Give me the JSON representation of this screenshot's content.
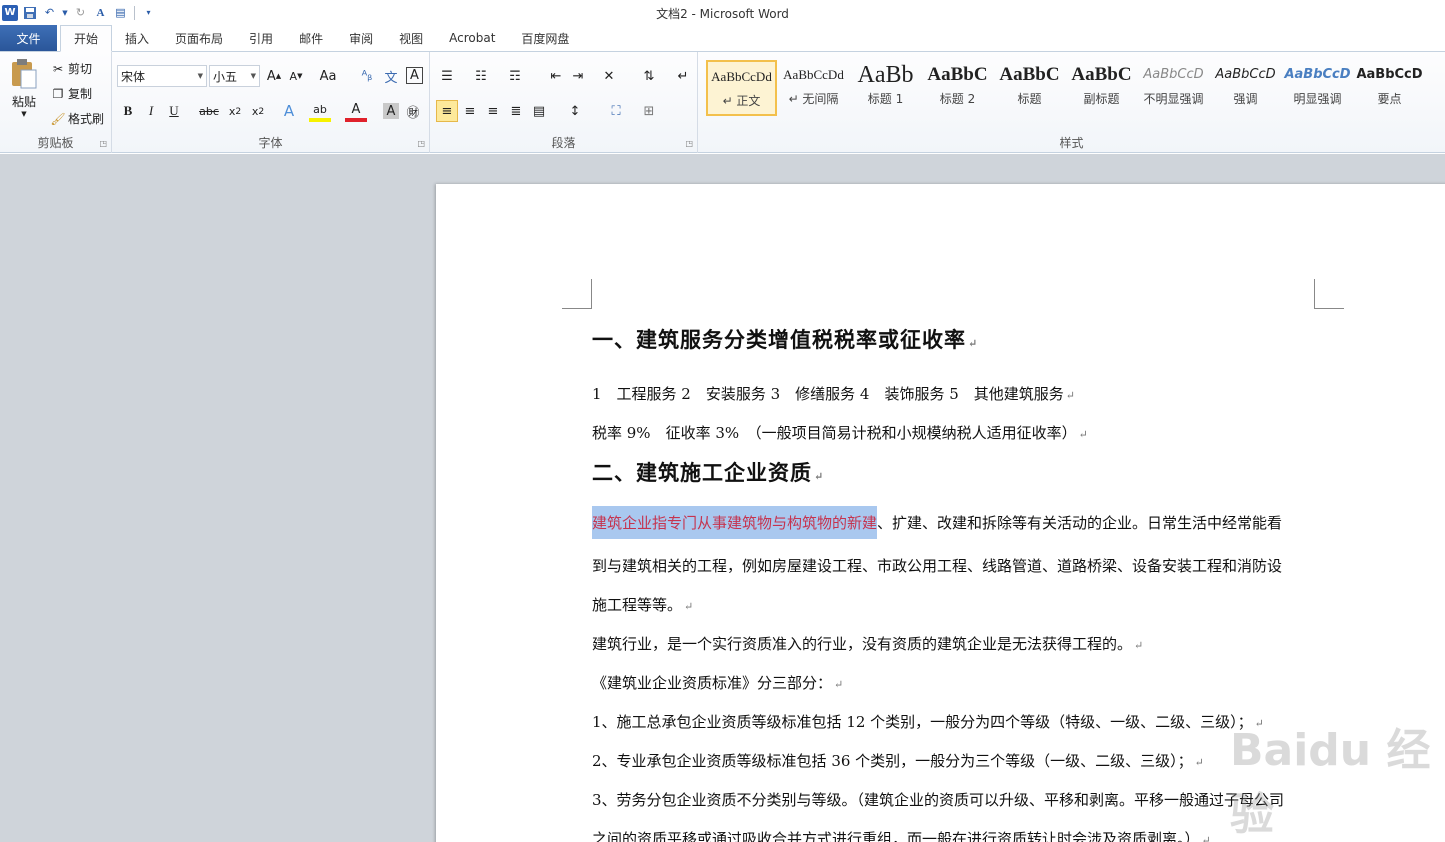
{
  "window": {
    "title": "文档2  -  Microsoft Word"
  },
  "qat": {
    "icons": [
      "word-icon",
      "save-icon",
      "undo-icon",
      "redo-icon",
      "format-icon",
      "paste-icon",
      "customize-icon"
    ]
  },
  "tabs": [
    {
      "label": "文件"
    },
    {
      "label": "开始"
    },
    {
      "label": "插入"
    },
    {
      "label": "页面布局"
    },
    {
      "label": "引用"
    },
    {
      "label": "邮件"
    },
    {
      "label": "审阅"
    },
    {
      "label": "视图"
    },
    {
      "label": "Acrobat"
    },
    {
      "label": "百度网盘"
    }
  ],
  "ribbon": {
    "clipboard": {
      "label": "剪贴板",
      "paste": "粘贴",
      "cut": "剪切",
      "copy": "复制",
      "format_painter": "格式刷"
    },
    "font": {
      "label": "字体",
      "font_name": "宋体",
      "font_size": "小五"
    },
    "paragraph": {
      "label": "段落"
    },
    "styles": {
      "label": "样式",
      "items": [
        {
          "sample": "AaBbCcDd",
          "name": "↵ 正文"
        },
        {
          "sample": "AaBbCcDd",
          "name": "↵ 无间隔"
        },
        {
          "sample": "AaBb",
          "name": "标题 1"
        },
        {
          "sample": "AaBbC",
          "name": "标题 2"
        },
        {
          "sample": "AaBbC",
          "name": "标题"
        },
        {
          "sample": "AaBbC",
          "name": "副标题"
        },
        {
          "sample": "AaBbCcD",
          "name": "不明显强调"
        },
        {
          "sample": "AaBbCcD",
          "name": "强调"
        },
        {
          "sample": "AaBbCcD",
          "name": "明显强调"
        },
        {
          "sample": "AaBbCcD",
          "name": "要点"
        }
      ]
    }
  },
  "document": {
    "heading1": "一、建筑服务分类增值税税率或征收率",
    "line1": "1　工程服务 2　安装服务 3　修缮服务 4　装饰服务 5　其他建筑服务",
    "line2": "税率 9%　征收率 3%　（一般项目简易计税和小规模纳税人适用征收率）",
    "heading2": "二、建筑施工企业资质",
    "para1_highlight": "建筑企业指专门从事建筑物与构筑物的新建",
    "para1_rest": "、扩建、改建和拆除等有关活动的企业。日常生活中经常能看",
    "para1_line2": "到与建筑相关的工程，例如房屋建设工程、市政公用工程、线路管道、道路桥梁、设备安装工程和消防设",
    "para1_line3": "施工程等等。",
    "para2": "建筑行业，是一个实行资质准入的行业，没有资质的建筑企业是无法获得工程的。",
    "para3": "《建筑业企业资质标准》分三部分：",
    "item1": "1、施工总承包企业资质等级标准包括 12 个类别，一般分为四个等级（特级、一级、二级、三级）；",
    "item2": "2、专业承包企业资质等级标准包括 36 个类别，一般分为三个等级（一级、二级、三级）；",
    "item3": "3、劳务分包企业资质不分类别与等级。（建筑企业的资质可以升级、平移和剥离。平移一般通过子母公司",
    "item3_line2": "之间的资质平移或通过吸收合并方式进行重组，而一般在进行资质转让时会涉及资质剥离。）",
    "paragraph_mark": "↵"
  },
  "watermark": "Baidu 经验"
}
